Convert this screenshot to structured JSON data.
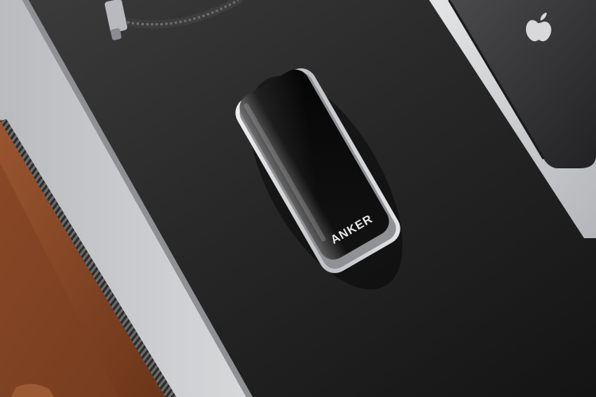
{
  "scene": {
    "device_brand": "ANKER",
    "icons": {
      "phone_logo": "apple-logo-icon"
    },
    "colors": {
      "desk_mat": "#2a2a2a",
      "laptop_silver": "#c7c9cb",
      "leather": "#8a4a28",
      "power_bank_body": "#0c0c0c",
      "power_bank_frame": "#d9dadc",
      "phone_body": "#2e2e30",
      "cable": "#3a3a3a"
    }
  }
}
